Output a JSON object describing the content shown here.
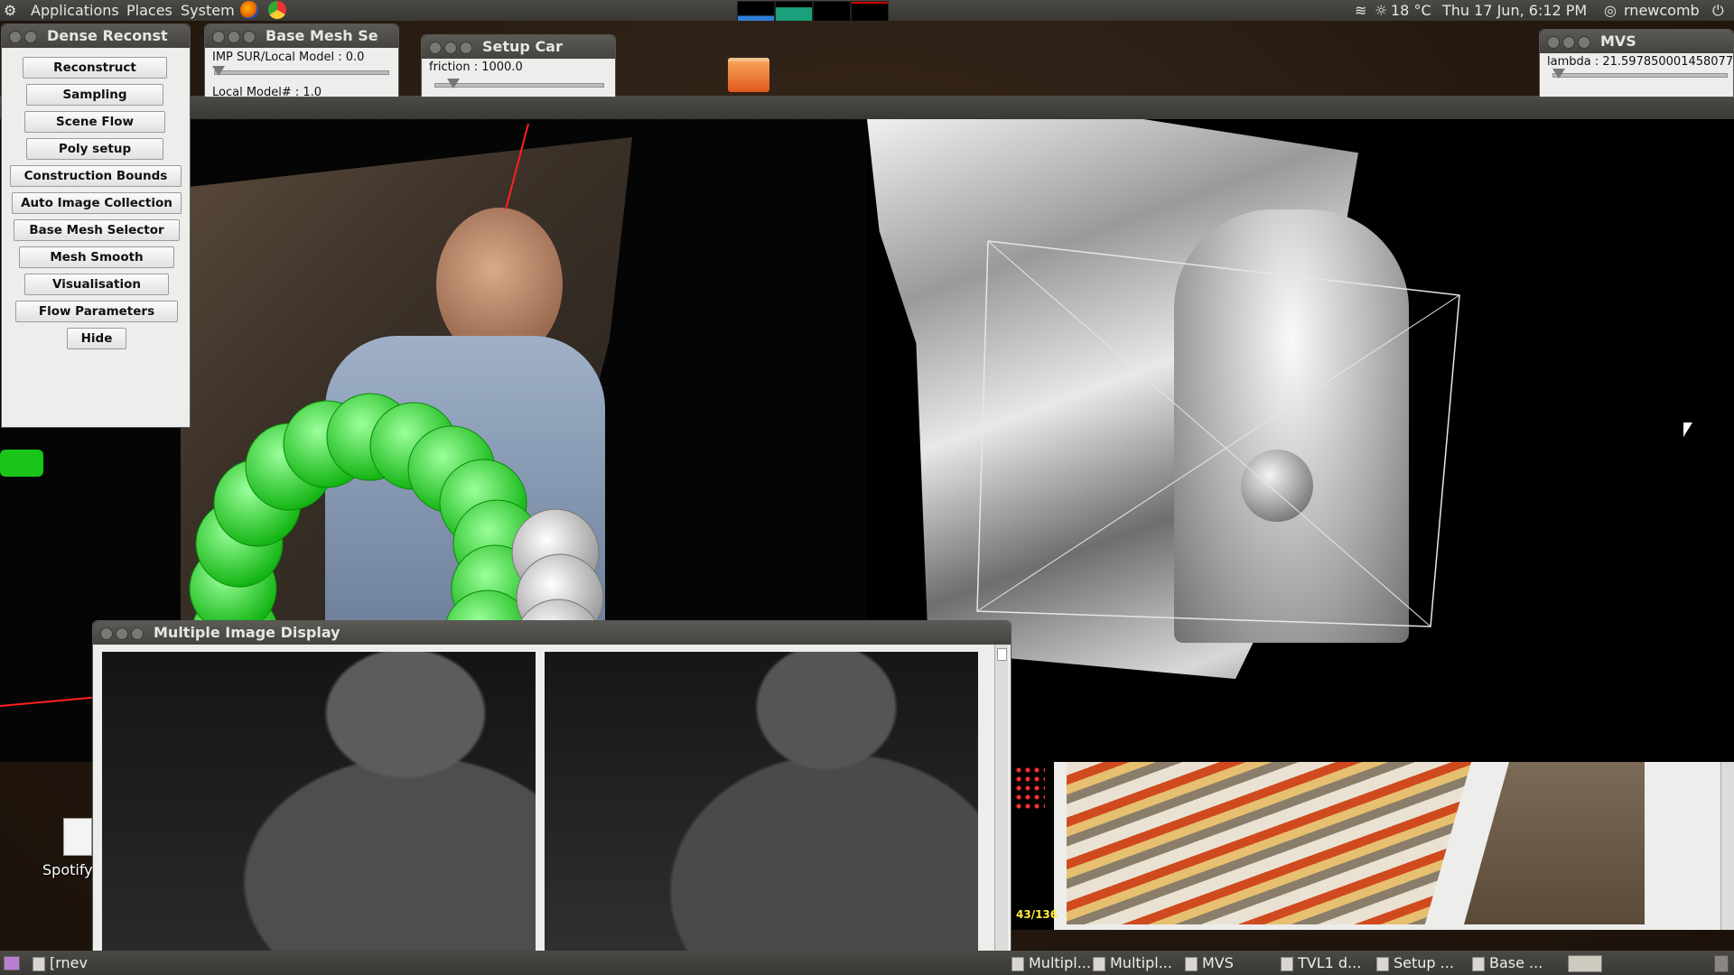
{
  "top_panel": {
    "menus": [
      "Applications",
      "Places",
      "System"
    ],
    "weather": "18 °C",
    "datetime": "Thu 17 Jun,  6:12 PM",
    "user": "rnewcomb"
  },
  "dense_panel": {
    "title": "Dense Reconst",
    "buttons": [
      "Reconstruct",
      "Sampling",
      "Scene Flow",
      "Poly setup",
      "Construction Bounds",
      "Auto Image Collection",
      "Base Mesh Selector",
      "Mesh Smooth",
      "Visualisation",
      "Flow Parameters",
      "Hide"
    ]
  },
  "base_mesh_window": {
    "title": "Base Mesh Se",
    "slider_label": "IMP SUR/Local Model : 0.0",
    "second_label": "Local Model# : 1.0"
  },
  "setup_car_window": {
    "title": "Setup Car",
    "slider_label": "friction : 1000.0"
  },
  "mvs_window": {
    "title": "MVS",
    "slider_label": "lambda : 21.597850001458077"
  },
  "multi_image_window": {
    "title": "Multiple Image Display"
  },
  "frame_counter": "43/136",
  "desktop_icon_label": "Spotify",
  "taskbar": {
    "left_task": "[rnev",
    "items": [
      "Multipl...",
      "Multipl...",
      "MVS",
      "TVL1 d...",
      "Setup ...",
      "Base ..."
    ]
  },
  "colors": {
    "panel_bg": "#3f3d39",
    "window_bg": "#ededeb",
    "tube_green": "#2ee02e",
    "axis_red": "#ff2020"
  }
}
